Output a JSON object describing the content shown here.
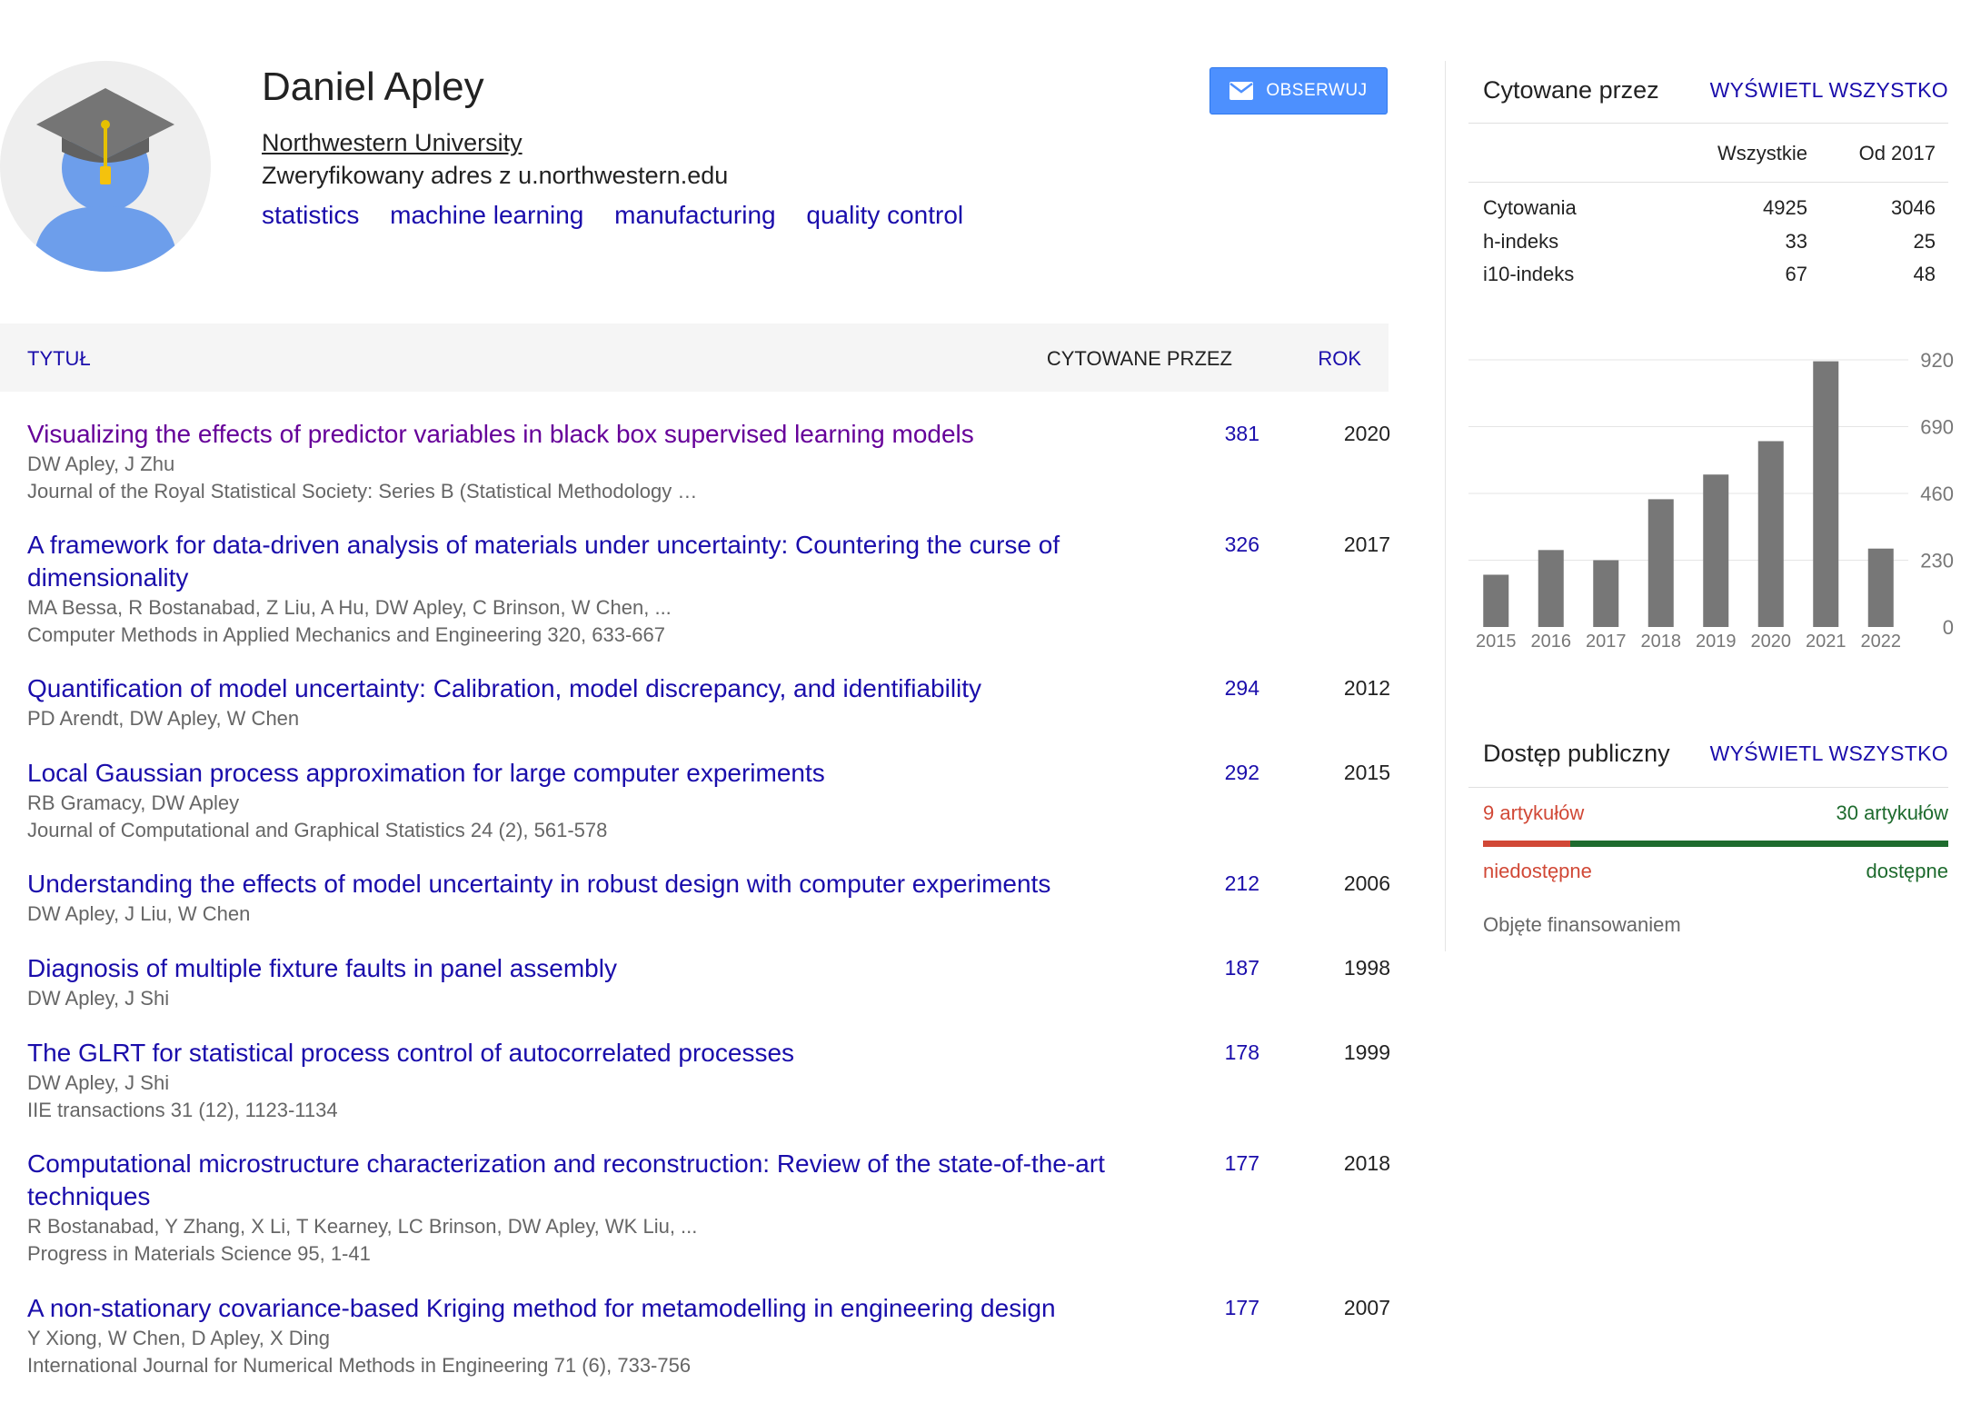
{
  "profile": {
    "name": "Daniel Apley",
    "affiliation": "Northwestern University",
    "verified_email": "Zweryfikowany adres z u.northwestern.edu",
    "interests": [
      "statistics",
      "machine learning",
      "manufacturing",
      "quality control"
    ],
    "follow_label": "OBSERWUJ",
    "avatar_icon": "graduate-avatar-icon"
  },
  "table": {
    "col_title": "TYTUŁ",
    "col_cited": "CYTOWANE PRZEZ",
    "col_year": "ROK"
  },
  "publications": [
    {
      "title": "Visualizing the effects of predictor variables in black box supervised learning models",
      "authors": "DW Apley, J Zhu",
      "venue": "Journal of the Royal Statistical Society: Series B (Statistical Methodology …",
      "cited": "381",
      "year": "2020",
      "visited": true
    },
    {
      "title": "A framework for data-driven analysis of materials under uncertainty: Countering the curse of dimensionality",
      "authors": "MA Bessa, R Bostanabad, Z Liu, A Hu, DW Apley, C Brinson, W Chen, ...",
      "venue": "Computer Methods in Applied Mechanics and Engineering 320, 633-667",
      "cited": "326",
      "year": "2017",
      "visited": false
    },
    {
      "title": "Quantification of model uncertainty: Calibration, model discrepancy, and identifiability",
      "authors": "PD Arendt, DW Apley, W Chen",
      "venue": "",
      "cited": "294",
      "year": "2012",
      "visited": false
    },
    {
      "title": "Local Gaussian process approximation for large computer experiments",
      "authors": "RB Gramacy, DW Apley",
      "venue": "Journal of Computational and Graphical Statistics 24 (2), 561-578",
      "cited": "292",
      "year": "2015",
      "visited": false
    },
    {
      "title": "Understanding the effects of model uncertainty in robust design with computer experiments",
      "authors": "DW Apley, J Liu, W Chen",
      "venue": "",
      "cited": "212",
      "year": "2006",
      "visited": false
    },
    {
      "title": "Diagnosis of multiple fixture faults in panel assembly",
      "authors": "DW Apley, J Shi",
      "venue": "",
      "cited": "187",
      "year": "1998",
      "visited": false
    },
    {
      "title": "The GLRT for statistical process control of autocorrelated processes",
      "authors": "DW Apley, J Shi",
      "venue": "IIE transactions 31 (12), 1123-1134",
      "cited": "178",
      "year": "1999",
      "visited": false
    },
    {
      "title": "Computational microstructure characterization and reconstruction: Review of the state-of-the-art techniques",
      "authors": "R Bostanabad, Y Zhang, X Li, T Kearney, LC Brinson, DW Apley, WK Liu, ...",
      "venue": "Progress in Materials Science 95, 1-41",
      "cited": "177",
      "year": "2018",
      "visited": false
    },
    {
      "title": "A non-stationary covariance-based Kriging method for metamodelling in engineering design",
      "authors": "Y Xiong, W Chen, D Apley, X Ding",
      "venue": "International Journal for Numerical Methods in Engineering 71 (6), 733-756",
      "cited": "177",
      "year": "2007",
      "visited": false
    }
  ],
  "cited_by": {
    "heading": "Cytowane przez",
    "view_all": "WYŚWIETL WSZYSTKO",
    "col_all": "Wszystkie",
    "col_since": "Od 2017",
    "rows": [
      {
        "label": "Cytowania",
        "all": "4925",
        "since": "3046"
      },
      {
        "label": "h-indeks",
        "all": "33",
        "since": "25"
      },
      {
        "label": "i10-indeks",
        "all": "67",
        "since": "48"
      }
    ]
  },
  "chart_data": {
    "type": "bar",
    "categories": [
      "2015",
      "2016",
      "2017",
      "2018",
      "2019",
      "2020",
      "2021",
      "2022"
    ],
    "values": [
      180,
      265,
      230,
      440,
      525,
      640,
      915,
      270
    ],
    "y_ticks": [
      0,
      230,
      460,
      690,
      920
    ],
    "ylim": [
      0,
      920
    ],
    "bar_color": "#777777",
    "grid": true
  },
  "public_access": {
    "heading": "Dostęp publiczny",
    "view_all": "WYŚWIETL WSZYSTKO",
    "unavailable_count": "9 artykułów",
    "available_count": "30 artykułów",
    "unavailable_label": "niedostępne",
    "available_label": "dostępne",
    "unavailable_fraction": 0.1875,
    "funded_label": "Objęte finansowaniem",
    "colors": {
      "unavailable": "#d14836",
      "available": "#1e6b2e"
    }
  },
  "colors": {
    "link": "#1a0dab",
    "visited_link": "#660099",
    "button": "#4d90fe"
  }
}
